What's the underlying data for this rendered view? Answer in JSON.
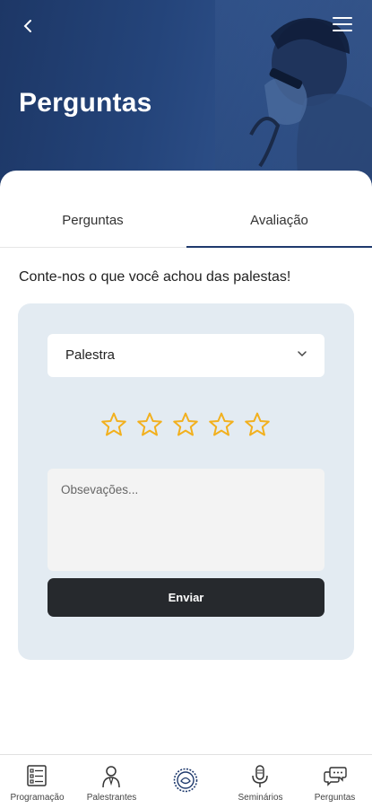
{
  "header": {
    "title": "Perguntas",
    "back_icon": "chevron-left-icon",
    "menu_icon": "hamburger-menu-icon"
  },
  "tabs": [
    {
      "label": "Perguntas",
      "active": false
    },
    {
      "label": "Avaliação",
      "active": true
    }
  ],
  "evaluation": {
    "intro": "Conte-nos o que você achou das palestas!",
    "select_value": "Palestra",
    "rating_max": 5,
    "rating_value": 0,
    "notes_placeholder": "Obsevações...",
    "submit_label": "Enviar"
  },
  "bottom_nav": [
    {
      "label": "Programação",
      "icon": "schedule-list-icon"
    },
    {
      "label": "Palestrantes",
      "icon": "speaker-person-icon"
    },
    {
      "label": "",
      "icon": "event-logo-icon"
    },
    {
      "label": "Seminários",
      "icon": "microphone-icon"
    },
    {
      "label": "Perguntas",
      "icon": "chat-bubbles-icon"
    }
  ],
  "colors": {
    "header_blue": "#24447a",
    "tab_indicator": "#1f3a6d",
    "card_bg": "#e3ebf2",
    "star": "#f2b01e",
    "button_dark": "#26292d"
  }
}
